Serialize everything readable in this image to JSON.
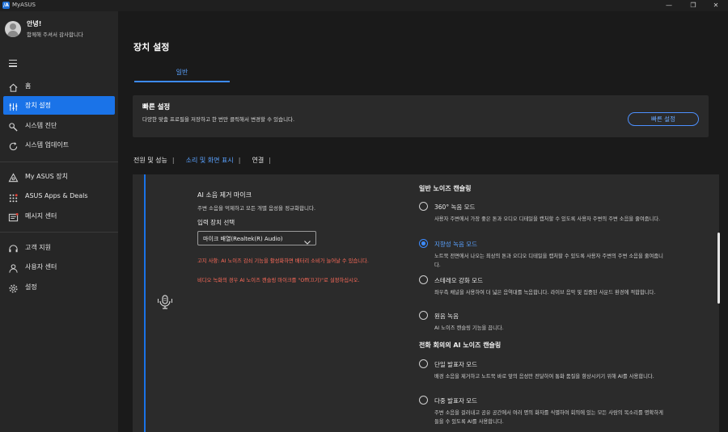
{
  "app": {
    "title": "MyASUS",
    "logo_text": "/A"
  },
  "window_controls": {
    "minimize": "—",
    "maximize": "❐",
    "close": "✕"
  },
  "user": {
    "greeting": "안녕!",
    "message": "함께해 주셔서 감사합니다"
  },
  "sidebar": {
    "items": [
      {
        "label": "홈",
        "icon": "home-icon"
      },
      {
        "label": "장치 설정",
        "icon": "sliders-icon",
        "active": true
      },
      {
        "label": "시스템 진단",
        "icon": "wrench-icon"
      },
      {
        "label": "시스템 업데이트",
        "icon": "update-icon"
      },
      {
        "label": "My ASUS 장치",
        "icon": "devices-icon"
      },
      {
        "label": "ASUS Apps & Deals",
        "icon": "apps-icon"
      },
      {
        "label": "메시지 센터",
        "icon": "message-icon"
      },
      {
        "label": "고객 지원",
        "icon": "headset-icon"
      },
      {
        "label": "사용자 센터",
        "icon": "user-icon"
      },
      {
        "label": "설정",
        "icon": "gear-icon"
      }
    ]
  },
  "main": {
    "page_title": "장치 설정",
    "tabs": [
      {
        "label": "일반",
        "active": true
      }
    ],
    "quick_settings": {
      "title": "빠른 설정",
      "description": "다양한 맞춤 프로필을 저장하고 한 번만 클릭해서 변경할 수 있습니다.",
      "button": "빠른 설정"
    },
    "subtabs": [
      {
        "label": "전원 및 성능"
      },
      {
        "label": "소리 및 화면 표시",
        "active": true
      },
      {
        "label": "연결"
      }
    ],
    "ai_mic": {
      "title": "AI 소음 제거 마이크",
      "description": "주변 소음을 억제하고 모든 개별 음성을 정규화합니다.",
      "input_label": "입력 장치 선택",
      "input_value": "마이크 배열(Realtek(R) Audio)",
      "warning_1": "고지 사항: AI 노이즈 감쇠 기능을 활성화하면 배터리 소비가 늘어날 수 있습니다.",
      "warning_2": "비디오 녹화의 경우 AI 노이즈 캔슬링 마이크를 \"Off(끄기)\"로 설정하십시오."
    },
    "general_nc": {
      "title": "일반 노이즈 캔슬링",
      "options": [
        {
          "label": "360° 녹음 모드",
          "desc": "사용자 주변에서 가장 좋은 톤과 오디오 디테일을 캡처할 수 있도록 사용자 주변의 주변 소음을 줄여줍니다.",
          "selected": false
        },
        {
          "label": "지향성 녹음 모드",
          "desc": "노트북 전면에서 나오는 최상의 톤과 오디오 디테일을 캡처할 수 있도록 사용자 주변의 주변 소음을 줄여줍니다.",
          "selected": true
        },
        {
          "label": "스테레오 강화 모드",
          "desc": "좌우측 채널을 사용하여 더 넓은 음역대를 녹음합니다. 라이브 음악 및 집중된 사운드 환경에 적합합니다.",
          "selected": false
        },
        {
          "label": "원음 녹음",
          "desc": "AI 노이즈 캔슬링 기능을 끕니다.",
          "selected": false
        }
      ]
    },
    "conference_nc": {
      "title": "전화 회의의 AI 노이즈 캔슬링",
      "options": [
        {
          "label": "단일 발표자 모드",
          "desc": "배경 소음을 제거하고 노트북 바로 앞의 음성만 전달하여 통화 품질을 향상시키기 위해 AI를 사용합니다.",
          "selected": false
        },
        {
          "label": "다중 발표자 모드",
          "desc": "주변 소음을 걸러내고 공유 공간에서 여러 명의 화자를 식별하여 회의에 있는 모든 사람의 목소리를 명확하게 들을 수 있도록 AI를 사용합니다.",
          "selected": false
        }
      ]
    }
  },
  "colors": {
    "accent": "#1a73e8",
    "link": "#5aa2ff",
    "warning": "#ff6b5a",
    "sidebar_bg": "#262626",
    "panel_bg": "#2b2b2b"
  }
}
